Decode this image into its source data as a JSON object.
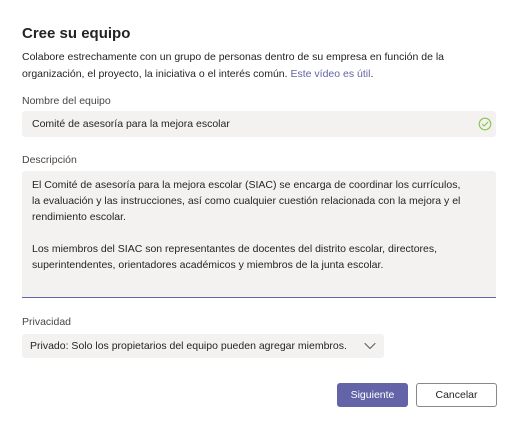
{
  "dialog": {
    "title": "Cree su equipo",
    "intro": "Colabore estrechamente con un grupo de personas dentro de su empresa en función de la organización, el proyecto, la iniciativa o el interés común.",
    "intro_link": "Este vídeo es útil",
    "intro_period": "."
  },
  "team_name": {
    "label": "Nombre del equipo",
    "value": "Comité de asesoría para la mejora escolar",
    "valid_icon": "check-circle-icon"
  },
  "description": {
    "label": "Descripción",
    "value": "El Comité de asesoría para la mejora escolar (SIAC) se encarga de coordinar los currículos,\nla evaluación y las instrucciones, así como cualquier cuestión relacionada con la mejora y el\nrendimiento escolar.\n\nLos miembros del SIAC son representantes de docentes del distrito escolar, directores,\nsuperintendentes, orientadores académicos y miembros de la junta escolar."
  },
  "privacy": {
    "label": "Privacidad",
    "selected": "Privado: Solo los propietarios del equipo pueden agregar miembros.",
    "icon": "chevron-down-icon"
  },
  "buttons": {
    "next": "Siguiente",
    "cancel": "Cancelar"
  },
  "colors": {
    "accent": "#6264a7",
    "valid": "#92c353"
  }
}
